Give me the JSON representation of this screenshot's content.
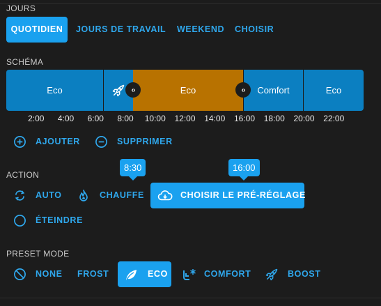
{
  "jours": {
    "label": "JOURS",
    "options": [
      "QUOTIDIEN",
      "JOURS DE TRAVAIL",
      "WEEKEND",
      "CHOISIR"
    ]
  },
  "schema": {
    "label": "SCHÉMA",
    "segments": [
      {
        "label": "Eco",
        "mode": "eco"
      },
      {
        "label": "",
        "mode": "boost",
        "icon": "rocket-icon"
      },
      {
        "label": "Eco",
        "mode": "heat"
      },
      {
        "label": "Comfort",
        "mode": "eco"
      },
      {
        "label": "Eco",
        "mode": "eco"
      }
    ],
    "ticks": [
      "2:00",
      "4:00",
      "6:00",
      "8:00",
      "10:00",
      "12:00",
      "14:00",
      "16:00",
      "18:00",
      "20:00",
      "22:00"
    ],
    "add_label": "AJOUTER",
    "remove_label": "SUPPRIMER"
  },
  "action": {
    "label": "ACTION",
    "tooltip_start": "8:30",
    "tooltip_end": "16:00",
    "options": [
      "AUTO",
      "CHAUFFE",
      "CHOISIR LE PRÉ-RÉGLAGE",
      "ÉTEINDRE"
    ]
  },
  "preset": {
    "label": "PRESET MODE",
    "options": [
      "NONE",
      "FROST",
      "ECO",
      "COMFORT",
      "BOOST"
    ]
  },
  "colors": {
    "accent": "#1aa1ef",
    "eco": "#0b7fc1",
    "heat": "#b87200",
    "background": "#1c1c1c"
  }
}
